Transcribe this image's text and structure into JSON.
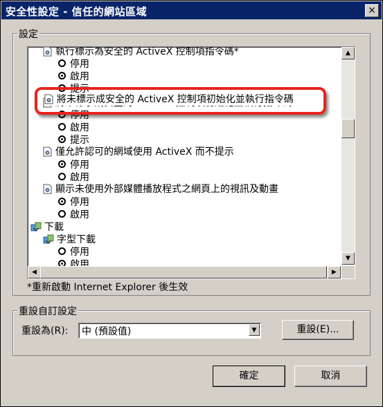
{
  "window": {
    "title": "安全性設定 - 信任的網站區域",
    "close_glyph": "×"
  },
  "settings_group": {
    "label": "設定"
  },
  "tree": [
    {
      "kind": "setting",
      "label": "執行標示為安全的 ActiveX 控制項指令碼*"
    },
    {
      "kind": "radio",
      "label": "停用",
      "checked": false
    },
    {
      "kind": "radio",
      "label": "啟用",
      "checked": true
    },
    {
      "kind": "radio",
      "label": "提示",
      "checked": false
    },
    {
      "kind": "setting",
      "label": "將未標示成安全的 ActiveX 控制項初始化並執行指令碼"
    },
    {
      "kind": "radio",
      "label": "停用",
      "checked": false
    },
    {
      "kind": "radio",
      "label": "啟用",
      "checked": false
    },
    {
      "kind": "radio",
      "label": "提示",
      "checked": true
    },
    {
      "kind": "setting",
      "label": "僅允許認可的網域使用 ActiveX 而不提示"
    },
    {
      "kind": "radio",
      "label": "停用",
      "checked": true
    },
    {
      "kind": "radio",
      "label": "啟用",
      "checked": false
    },
    {
      "kind": "setting",
      "label": "顯示未使用外部媒體播放程式之網頁上的視訊及動畫"
    },
    {
      "kind": "radio",
      "label": "停用",
      "checked": true
    },
    {
      "kind": "radio",
      "label": "啟用",
      "checked": false
    },
    {
      "kind": "category",
      "label": "下載"
    },
    {
      "kind": "subcategory",
      "label": "字型下載"
    },
    {
      "kind": "radio",
      "label": "停用",
      "checked": false
    },
    {
      "kind": "radio",
      "label": "啟用",
      "checked": true
    }
  ],
  "highlight_label": "將未標示成安全的 ActiveX 控制項初始化並執行指令碼",
  "scroll_glyphs": {
    "up": "▲",
    "down": "▼",
    "left": "◀",
    "right": "▶"
  },
  "restart_note": "*重新啟動 Internet Explorer 後生效",
  "reset_group": {
    "label": "重設自訂設定",
    "reset_to_label": "重設為(R):",
    "select_value": "中 (預設值)",
    "reset_button": "重設(E)..."
  },
  "footer": {
    "ok": "確定",
    "cancel": "取消"
  },
  "colors": {
    "titlebar": "#0a246a",
    "highlight": "#e8231b",
    "face": "#d4d0c8"
  }
}
